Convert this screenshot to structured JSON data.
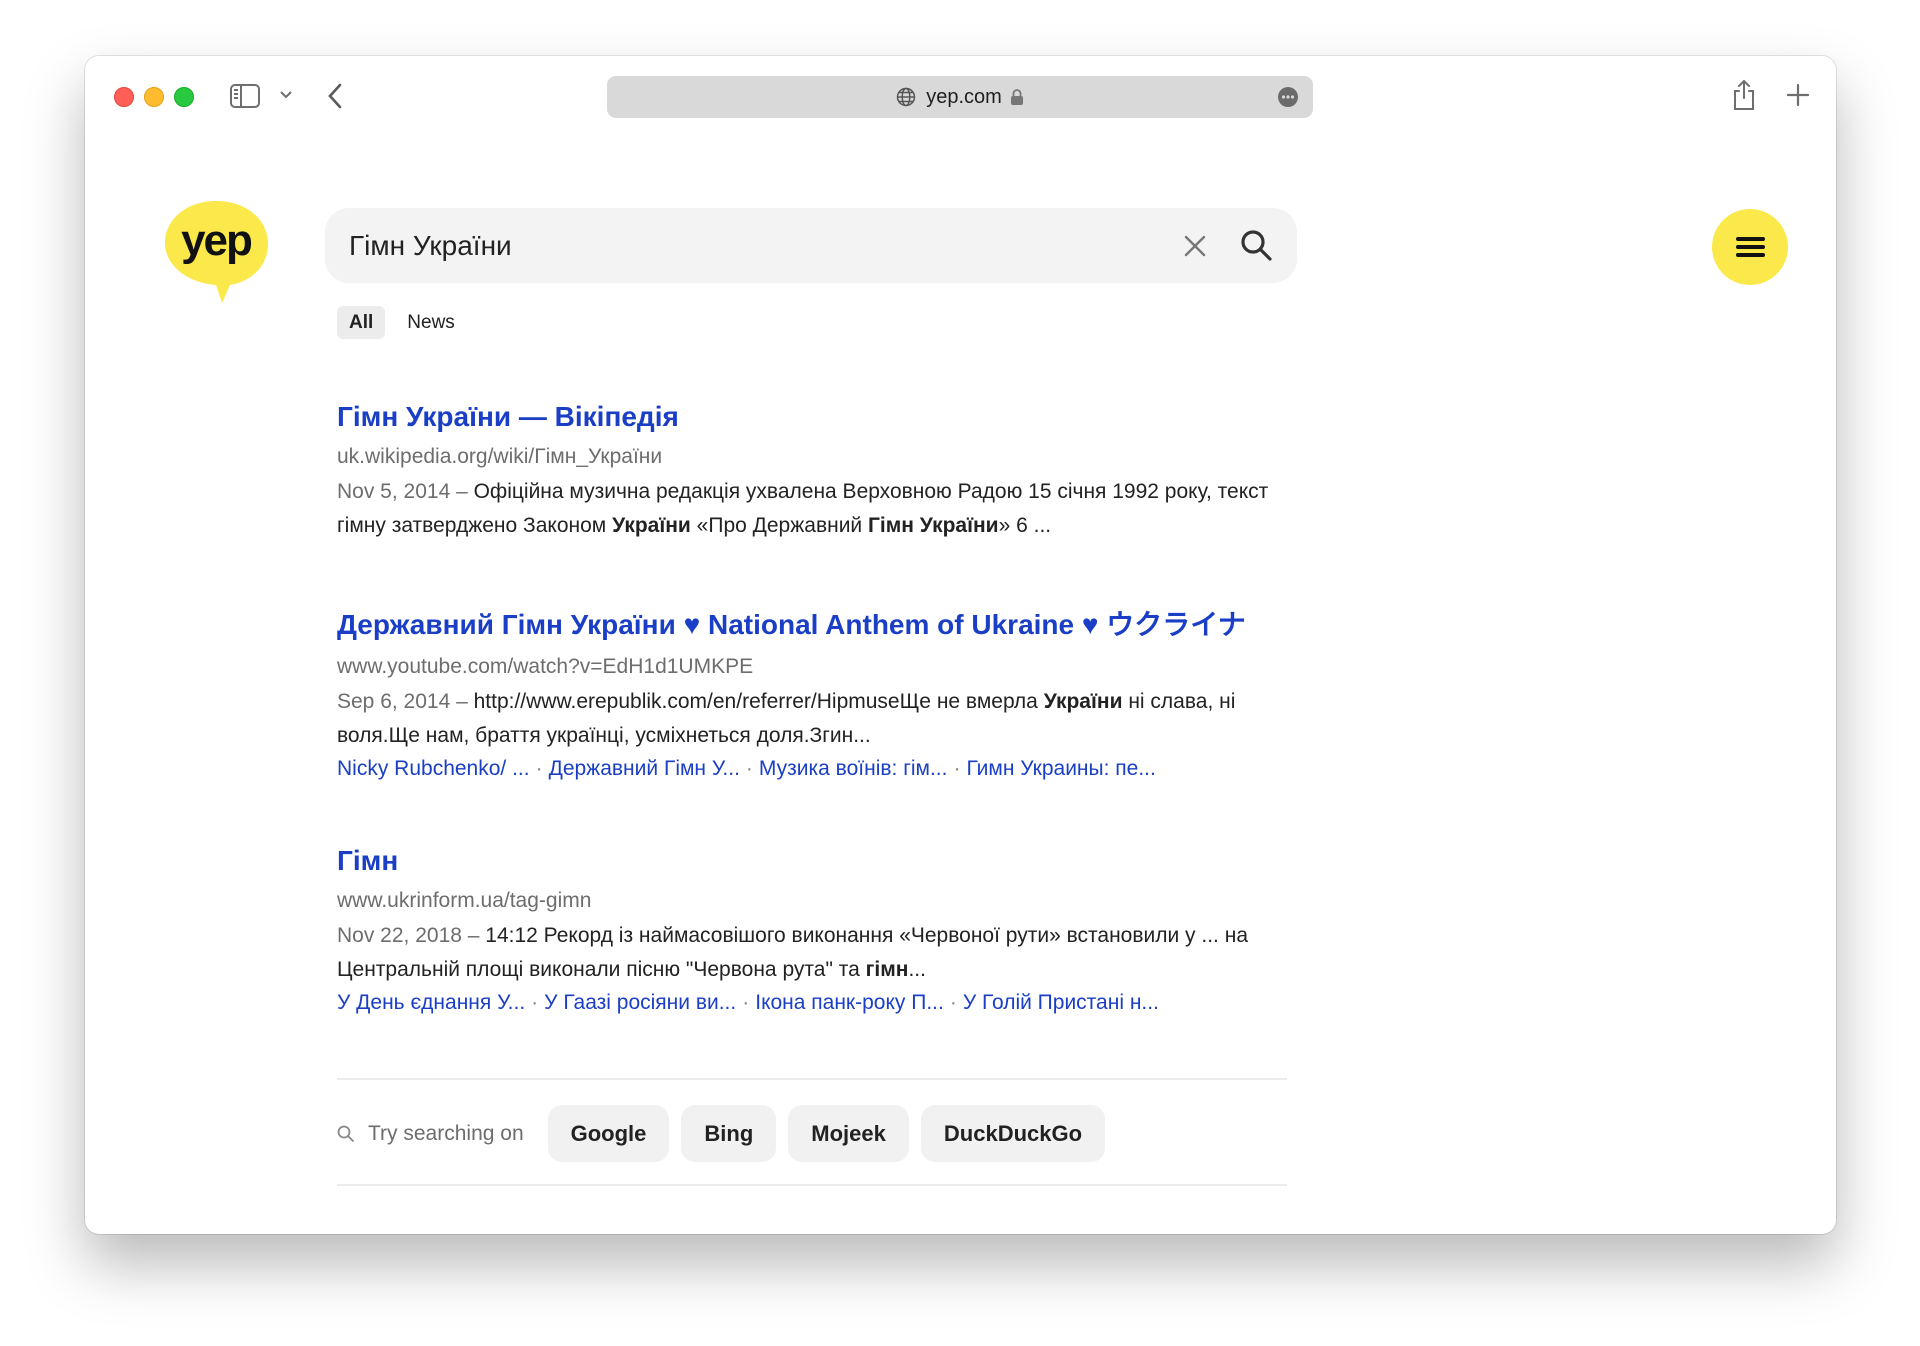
{
  "browser": {
    "url": "yep.com",
    "icons": [
      "sidebar-icon",
      "chevron-down-icon",
      "back-icon",
      "globe-icon",
      "lock-icon",
      "more-icon",
      "share-icon",
      "plus-icon"
    ]
  },
  "site": {
    "logo_text": "yep",
    "brand_color": "#fbe94b",
    "link_color": "#1a3ec5"
  },
  "search": {
    "query": "Гімн України"
  },
  "tabs": [
    {
      "label": "All",
      "active": true
    },
    {
      "label": "News",
      "active": false
    }
  ],
  "results": [
    {
      "title": "Гімн України — Вікіпедія",
      "url": "uk.wikipedia.org/wiki/Гімн_України",
      "date": "Nov 5, 2014 –",
      "snippet_parts": [
        {
          "t": " Офіційна музична редакція ухвалена Верховною Радою 15 січня 1992 року, текст гімну затверджено Законом ",
          "b": false
        },
        {
          "t": "України",
          "b": true
        },
        {
          "t": " «Про Державний ",
          "b": false
        },
        {
          "t": "Гімн України",
          "b": true
        },
        {
          "t": "» 6 ...",
          "b": false
        }
      ],
      "links": []
    },
    {
      "title": "Державний Гімн України ♥ National Anthem of Ukraine ♥ ウクライナ",
      "url": "www.youtube.com/watch?v=EdH1d1UMKPE",
      "date": "Sep 6, 2014 –",
      "snippet_parts": [
        {
          "t": " http://www.erepublik.com/en/referrer/HipmuseЩе не вмерла ",
          "b": false
        },
        {
          "t": "України",
          "b": true
        },
        {
          "t": " ні слава, ні воля.Ще нам, браття українці, усміхнеться доля.Згин...",
          "b": false
        }
      ],
      "links": [
        "Nicky Rubchenko/ ...",
        "Державний Гімн У...",
        "Музика воїнів: гім...",
        "Гимн Украины: пе..."
      ]
    },
    {
      "title": "Гімн",
      "url": "www.ukrinform.ua/tag-gimn",
      "date": "Nov 22, 2018 –",
      "snippet_parts": [
        {
          "t": " 14:12 Рекорд із наймасовішого виконання «Червоної рути» встановили у ... на Центральній площі виконали пісню \"Червона рута\" та ",
          "b": false
        },
        {
          "t": "гімн",
          "b": true
        },
        {
          "t": "...",
          "b": false
        }
      ],
      "links": [
        "У День єднання У...",
        "У Гаазі росіяни ви...",
        "Ікона панк-року П...",
        "У Голій Пристані н..."
      ]
    }
  ],
  "try_searching": {
    "label": "Try searching on",
    "engines": [
      "Google",
      "Bing",
      "Mojeek",
      "DuckDuckGo"
    ]
  }
}
